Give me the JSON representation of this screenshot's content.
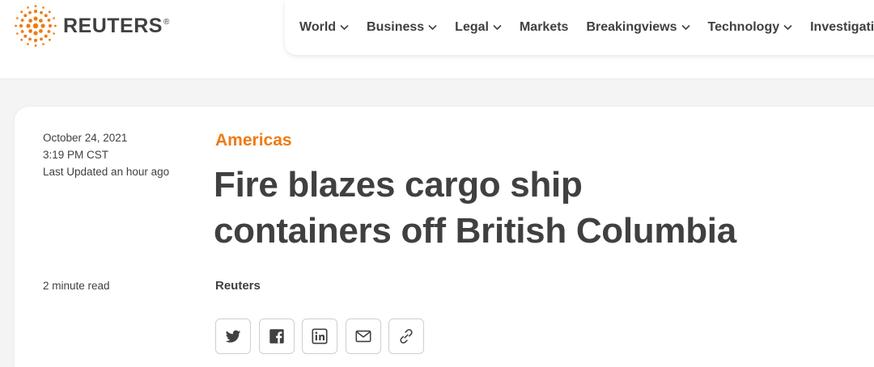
{
  "brand": {
    "name": "REUTERS",
    "registered": "®",
    "accent_color": "#ef7b14"
  },
  "nav": {
    "items": [
      {
        "label": "World",
        "has_dropdown": true
      },
      {
        "label": "Business",
        "has_dropdown": true
      },
      {
        "label": "Legal",
        "has_dropdown": true
      },
      {
        "label": "Markets",
        "has_dropdown": false
      },
      {
        "label": "Breakingviews",
        "has_dropdown": true
      },
      {
        "label": "Technology",
        "has_dropdown": true
      },
      {
        "label": "Investigations",
        "has_dropdown": false
      }
    ]
  },
  "article": {
    "date": "October 24, 2021",
    "time": "3:19 PM CST",
    "updated": "Last Updated an hour ago",
    "read_time": "2 minute read",
    "section": "Americas",
    "headline_line1": "Fire blazes cargo ship",
    "headline_line2": "containers off British Columbia",
    "byline": "Reuters"
  },
  "share": {
    "buttons": [
      {
        "icon": "twitter-icon"
      },
      {
        "icon": "facebook-icon"
      },
      {
        "icon": "linkedin-icon"
      },
      {
        "icon": "email-icon"
      },
      {
        "icon": "link-icon"
      }
    ]
  }
}
